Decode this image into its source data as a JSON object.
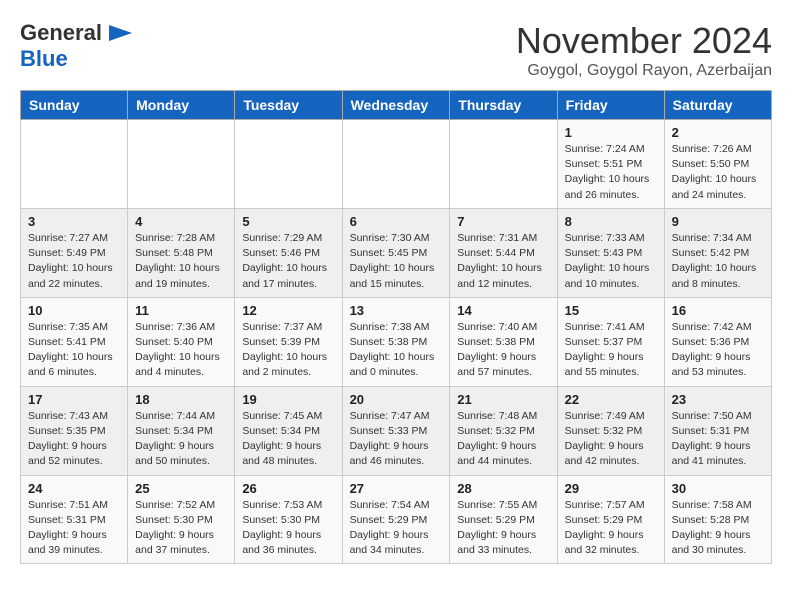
{
  "logo": {
    "general": "General",
    "blue": "Blue"
  },
  "header": {
    "month": "November 2024",
    "location": "Goygol, Goygol Rayon, Azerbaijan"
  },
  "weekdays": [
    "Sunday",
    "Monday",
    "Tuesday",
    "Wednesday",
    "Thursday",
    "Friday",
    "Saturday"
  ],
  "weeks": [
    [
      {
        "day": "",
        "info": ""
      },
      {
        "day": "",
        "info": ""
      },
      {
        "day": "",
        "info": ""
      },
      {
        "day": "",
        "info": ""
      },
      {
        "day": "",
        "info": ""
      },
      {
        "day": "1",
        "info": "Sunrise: 7:24 AM\nSunset: 5:51 PM\nDaylight: 10 hours and 26 minutes."
      },
      {
        "day": "2",
        "info": "Sunrise: 7:26 AM\nSunset: 5:50 PM\nDaylight: 10 hours and 24 minutes."
      }
    ],
    [
      {
        "day": "3",
        "info": "Sunrise: 7:27 AM\nSunset: 5:49 PM\nDaylight: 10 hours and 22 minutes."
      },
      {
        "day": "4",
        "info": "Sunrise: 7:28 AM\nSunset: 5:48 PM\nDaylight: 10 hours and 19 minutes."
      },
      {
        "day": "5",
        "info": "Sunrise: 7:29 AM\nSunset: 5:46 PM\nDaylight: 10 hours and 17 minutes."
      },
      {
        "day": "6",
        "info": "Sunrise: 7:30 AM\nSunset: 5:45 PM\nDaylight: 10 hours and 15 minutes."
      },
      {
        "day": "7",
        "info": "Sunrise: 7:31 AM\nSunset: 5:44 PM\nDaylight: 10 hours and 12 minutes."
      },
      {
        "day": "8",
        "info": "Sunrise: 7:33 AM\nSunset: 5:43 PM\nDaylight: 10 hours and 10 minutes."
      },
      {
        "day": "9",
        "info": "Sunrise: 7:34 AM\nSunset: 5:42 PM\nDaylight: 10 hours and 8 minutes."
      }
    ],
    [
      {
        "day": "10",
        "info": "Sunrise: 7:35 AM\nSunset: 5:41 PM\nDaylight: 10 hours and 6 minutes."
      },
      {
        "day": "11",
        "info": "Sunrise: 7:36 AM\nSunset: 5:40 PM\nDaylight: 10 hours and 4 minutes."
      },
      {
        "day": "12",
        "info": "Sunrise: 7:37 AM\nSunset: 5:39 PM\nDaylight: 10 hours and 2 minutes."
      },
      {
        "day": "13",
        "info": "Sunrise: 7:38 AM\nSunset: 5:38 PM\nDaylight: 10 hours and 0 minutes."
      },
      {
        "day": "14",
        "info": "Sunrise: 7:40 AM\nSunset: 5:38 PM\nDaylight: 9 hours and 57 minutes."
      },
      {
        "day": "15",
        "info": "Sunrise: 7:41 AM\nSunset: 5:37 PM\nDaylight: 9 hours and 55 minutes."
      },
      {
        "day": "16",
        "info": "Sunrise: 7:42 AM\nSunset: 5:36 PM\nDaylight: 9 hours and 53 minutes."
      }
    ],
    [
      {
        "day": "17",
        "info": "Sunrise: 7:43 AM\nSunset: 5:35 PM\nDaylight: 9 hours and 52 minutes."
      },
      {
        "day": "18",
        "info": "Sunrise: 7:44 AM\nSunset: 5:34 PM\nDaylight: 9 hours and 50 minutes."
      },
      {
        "day": "19",
        "info": "Sunrise: 7:45 AM\nSunset: 5:34 PM\nDaylight: 9 hours and 48 minutes."
      },
      {
        "day": "20",
        "info": "Sunrise: 7:47 AM\nSunset: 5:33 PM\nDaylight: 9 hours and 46 minutes."
      },
      {
        "day": "21",
        "info": "Sunrise: 7:48 AM\nSunset: 5:32 PM\nDaylight: 9 hours and 44 minutes."
      },
      {
        "day": "22",
        "info": "Sunrise: 7:49 AM\nSunset: 5:32 PM\nDaylight: 9 hours and 42 minutes."
      },
      {
        "day": "23",
        "info": "Sunrise: 7:50 AM\nSunset: 5:31 PM\nDaylight: 9 hours and 41 minutes."
      }
    ],
    [
      {
        "day": "24",
        "info": "Sunrise: 7:51 AM\nSunset: 5:31 PM\nDaylight: 9 hours and 39 minutes."
      },
      {
        "day": "25",
        "info": "Sunrise: 7:52 AM\nSunset: 5:30 PM\nDaylight: 9 hours and 37 minutes."
      },
      {
        "day": "26",
        "info": "Sunrise: 7:53 AM\nSunset: 5:30 PM\nDaylight: 9 hours and 36 minutes."
      },
      {
        "day": "27",
        "info": "Sunrise: 7:54 AM\nSunset: 5:29 PM\nDaylight: 9 hours and 34 minutes."
      },
      {
        "day": "28",
        "info": "Sunrise: 7:55 AM\nSunset: 5:29 PM\nDaylight: 9 hours and 33 minutes."
      },
      {
        "day": "29",
        "info": "Sunrise: 7:57 AM\nSunset: 5:29 PM\nDaylight: 9 hours and 32 minutes."
      },
      {
        "day": "30",
        "info": "Sunrise: 7:58 AM\nSunset: 5:28 PM\nDaylight: 9 hours and 30 minutes."
      }
    ]
  ]
}
